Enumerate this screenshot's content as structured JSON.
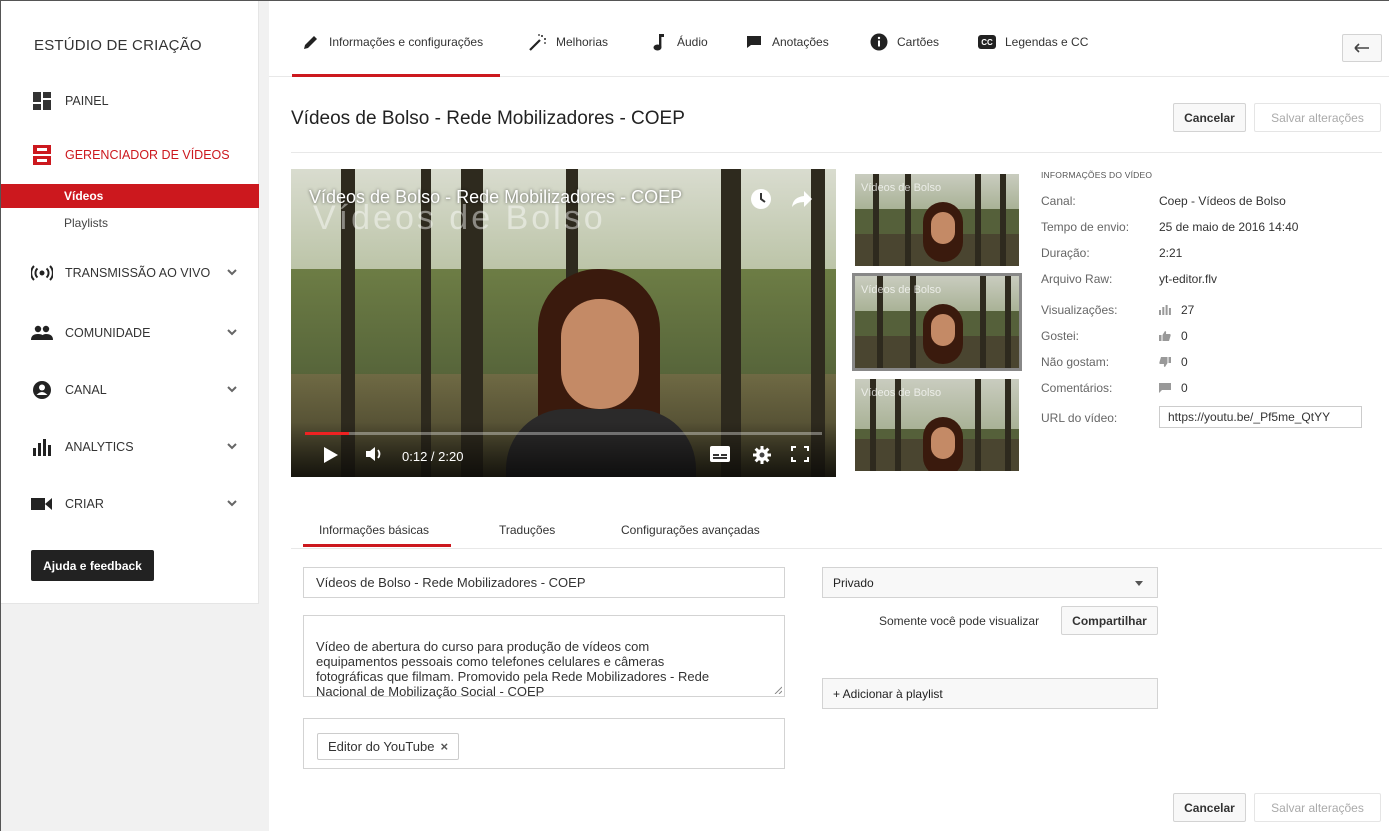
{
  "sidebar": {
    "title": "ESTÚDIO DE CRIAÇÃO",
    "items": [
      {
        "label": "PAINEL",
        "icon": "dashboard-icon"
      },
      {
        "label": "GERENCIADOR DE VÍDEOS",
        "icon": "video-manager-icon"
      },
      {
        "label": "TRANSMISSÃO AO VIVO",
        "icon": "live-icon"
      },
      {
        "label": "COMUNIDADE",
        "icon": "community-icon"
      },
      {
        "label": "CANAL",
        "icon": "channel-icon"
      },
      {
        "label": "ANALYTICS",
        "icon": "analytics-icon"
      },
      {
        "label": "CRIAR",
        "icon": "create-icon"
      }
    ],
    "subitems": [
      {
        "label": "Vídeos",
        "active": true
      },
      {
        "label": "Playlists",
        "active": false
      }
    ],
    "help_button": "Ajuda e feedback"
  },
  "tabs": [
    {
      "label": "Informações e configurações",
      "icon": "pencil-icon",
      "active": true
    },
    {
      "label": "Melhorias",
      "icon": "magic-wand-icon"
    },
    {
      "label": "Áudio",
      "icon": "music-note-icon"
    },
    {
      "label": "Anotações",
      "icon": "speech-bubble-icon"
    },
    {
      "label": "Cartões",
      "icon": "info-icon"
    },
    {
      "label": "Legendas e CC",
      "icon": "cc-icon"
    }
  ],
  "video": {
    "title": "Vídeos de Bolso - Rede Mobilizadores - COEP",
    "player_title": "Vídeos de Bolso - Rede Mobilizadores - COEP",
    "watermark": "Vídeos de Bolso",
    "time": "0:12 / 2:20",
    "progress": 0.086
  },
  "thumbs": [
    {
      "watermark": "Vídeos de Bolso",
      "selected": false
    },
    {
      "watermark": "Vídeos de Bolso",
      "selected": true
    },
    {
      "watermark": "Vídeos de Bolso",
      "selected": false
    }
  ],
  "buttons": {
    "cancel": "Cancelar",
    "save": "Salvar alterações"
  },
  "info": {
    "title": "INFORMAÇÕES DO VÍDEO",
    "rows": [
      {
        "label": "Canal:",
        "value": "Coep - Vídeos de Bolso"
      },
      {
        "label": "Tempo de envio:",
        "value": "25 de maio de 2016 14:40"
      },
      {
        "label": "Duração:",
        "value": "2:21"
      },
      {
        "label": "Arquivo Raw:",
        "value": "yt-editor.flv"
      },
      {
        "label": "Visualizações:",
        "value": "27",
        "icon": "bar-chart-icon"
      },
      {
        "label": "Gostei:",
        "value": "0",
        "icon": "thumbs-up-icon"
      },
      {
        "label": "Não gostam:",
        "value": "0",
        "icon": "thumbs-down-icon"
      },
      {
        "label": "Comentários:",
        "value": "0",
        "icon": "comment-icon"
      }
    ],
    "url_label": "URL do vídeo:",
    "url_value": "https://youtu.be/_Pf5me_QtYY"
  },
  "lower_tabs": [
    {
      "label": "Informações básicas",
      "active": true
    },
    {
      "label": "Traduções"
    },
    {
      "label": "Configurações avançadas"
    }
  ],
  "form": {
    "title_value": "Vídeos de Bolso - Rede Mobilizadores - COEP",
    "description": "Vídeo de abertura do curso para produção de vídeos com\nequipamentos pessoais como telefones celulares e câmeras\nfotográficas que filmam. Promovido pela Rede Mobilizadores - Rede\nNacional de Mobilização Social - COEP",
    "tag": "Editor do YouTube",
    "privacy": "Privado",
    "privacy_note": "Somente você pode visualizar",
    "share_button": "Compartilhar",
    "playlist_button": "+ Adicionar à playlist"
  },
  "colors": {
    "accent": "#cc181e"
  }
}
